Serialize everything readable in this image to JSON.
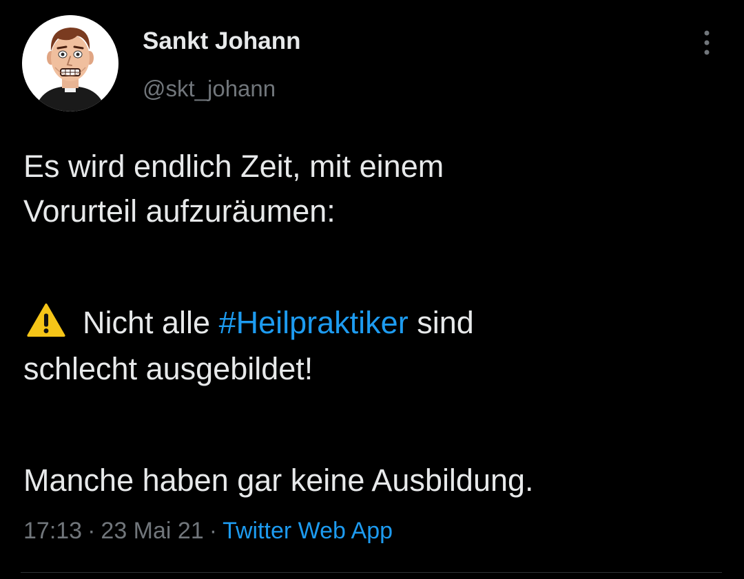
{
  "author": {
    "display_name": "Sankt Johann",
    "handle": "@skt_johann",
    "avatar_icon": "cartoon-avatar"
  },
  "more_icon": "vertical-ellipsis-icon",
  "tweet": {
    "line1": "Es wird endlich Zeit, mit einem",
    "line2": "Vorurteil aufzuräumen:",
    "warning_icon": "warning-icon",
    "line3_before": "Nicht alle",
    "hashtag": "#Heilpraktiker",
    "line3_after": "sind",
    "line4": "schlecht ausgebildet!",
    "line5": "Manche haben gar keine Ausbildung."
  },
  "meta": {
    "time": "17:13",
    "separator": "·",
    "date": "23 Mai 21",
    "source": "Twitter Web App"
  },
  "colors": {
    "background": "#000000",
    "text": "#e7e9ea",
    "secondary_text": "#71767b",
    "accent": "#1d9bf0",
    "warning": "#f5c518"
  }
}
